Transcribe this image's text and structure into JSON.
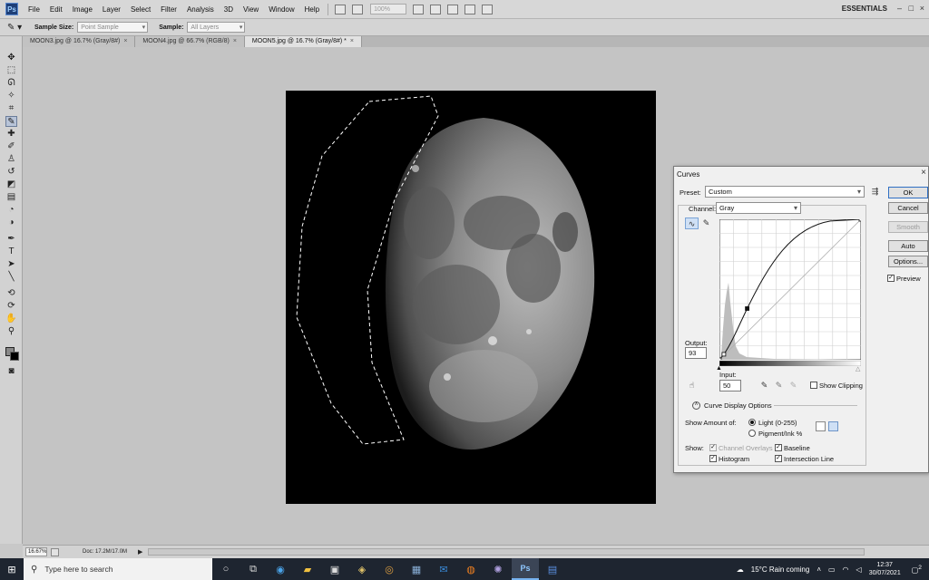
{
  "menubar": {
    "logo": "Ps",
    "items": [
      "File",
      "Edit",
      "Image",
      "Layer",
      "Select",
      "Filter",
      "Analysis",
      "3D",
      "View",
      "Window",
      "Help"
    ],
    "zoom": "100%",
    "workspace": "ESSENTIALS",
    "window_controls": [
      "–",
      "□",
      "×"
    ]
  },
  "options": {
    "sample_size_label": "Sample Size:",
    "sample_size_value": "Point Sample",
    "sample_label": "Sample:",
    "sample_value": "All Layers"
  },
  "tabs": [
    {
      "label": "MOON3.jpg @ 16.7% (Gray/8#)",
      "close": "×"
    },
    {
      "label": "MOON4.jpg @ 66.7% (RGB/8)",
      "close": "×"
    },
    {
      "label": "MOON5.jpg @ 16.7% (Gray/8#) *",
      "close": "×"
    }
  ],
  "status": {
    "zoom": "16.67%",
    "doc": "Doc: 17.2M/17.0M",
    "arrow": "▶"
  },
  "curves": {
    "title": "Curves",
    "close": "×",
    "preset_label": "Preset:",
    "preset_value": "Custom",
    "channel_label": "Channel:",
    "channel_value": "Gray",
    "output_label": "Output:",
    "output_value": "93",
    "input_label": "Input:",
    "input_value": "50",
    "show_clipping": "Show Clipping",
    "curve_display_options": "Curve Display Options",
    "show_amount_label": "Show Amount of:",
    "light_label": "Light  (0-255)",
    "pigment_label": "Pigment/Ink %",
    "show_label": "Show:",
    "channel_overlays": "Channel Overlays",
    "baseline": "Baseline",
    "histogram": "Histogram",
    "intersection_line": "Intersection Line",
    "buttons": {
      "ok": "OK",
      "cancel": "Cancel",
      "smooth": "Smooth",
      "auto": "Auto",
      "options": "Options..."
    },
    "preview": "Preview",
    "check_mark": "✓",
    "control_points": [
      {
        "input": 0,
        "output": 0
      },
      {
        "input": 8,
        "output": 10
      },
      {
        "input": 50,
        "output": 93
      },
      {
        "input": 255,
        "output": 255
      }
    ]
  },
  "taskbar": {
    "search_placeholder": "Type here to search",
    "weather": "15°C  Rain coming",
    "time": "12:37",
    "date": "30/07/2021",
    "notification_count": "2"
  }
}
